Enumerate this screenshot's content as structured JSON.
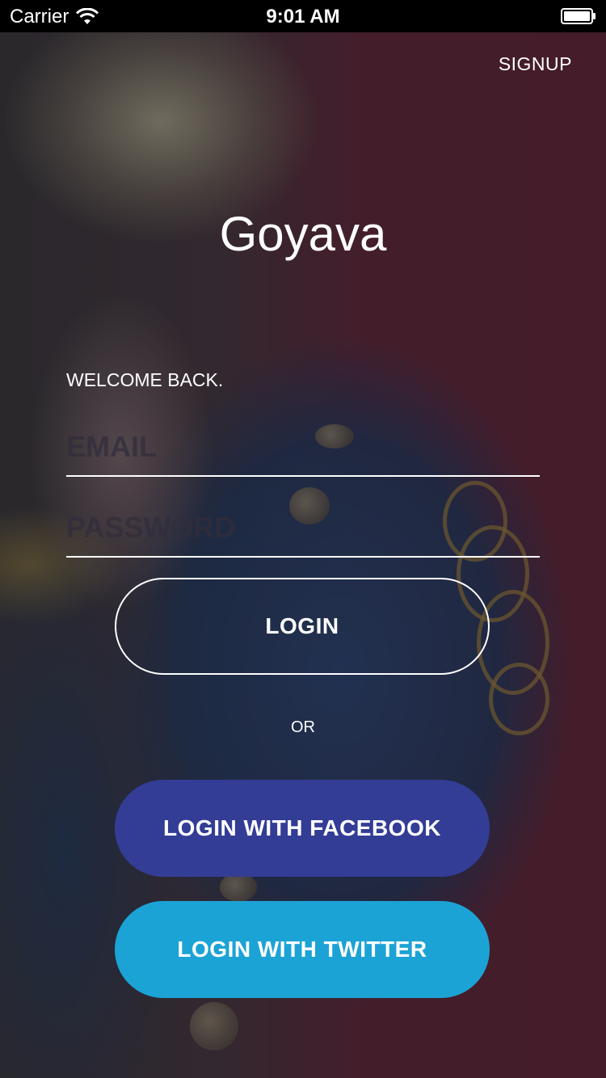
{
  "status_bar": {
    "carrier": "Carrier",
    "time": "9:01 AM"
  },
  "header": {
    "signup_label": "SIGNUP"
  },
  "app": {
    "title": "Goyava"
  },
  "form": {
    "welcome": "WELCOME BACK.",
    "email_placeholder": "EMAIL",
    "email_value": "",
    "password_placeholder": "PASSWORD",
    "password_value": "",
    "login_label": "LOGIN",
    "or_label": "OR"
  },
  "social": {
    "facebook_label": "LOGIN WITH FACEBOOK",
    "twitter_label": "LOGIN WITH TWITTER"
  },
  "colors": {
    "facebook": "#333d96",
    "twitter": "#1ca3d6",
    "text": "#ffffff"
  },
  "icons": [
    "wifi-icon",
    "battery-icon"
  ]
}
